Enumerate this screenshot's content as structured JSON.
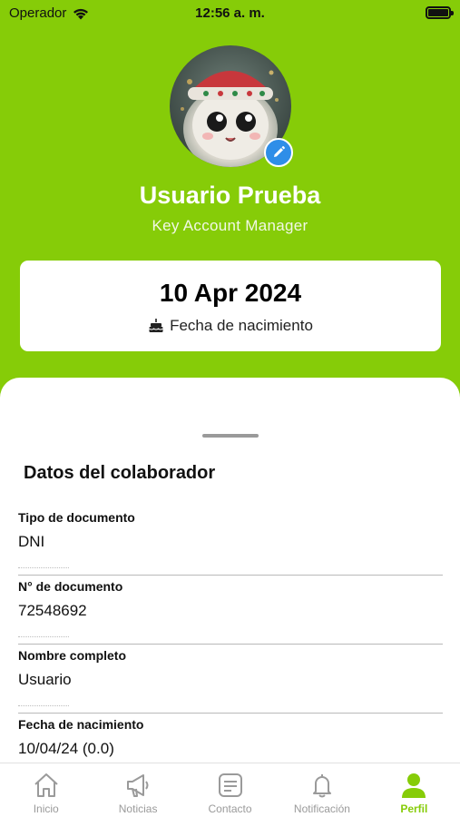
{
  "status_bar": {
    "carrier": "Operador",
    "time": "12:56 a. m.",
    "battery_level": 1.0
  },
  "profile": {
    "name": "Usuario Prueba",
    "role": "Key Account Manager",
    "avatar_icon": "fluffy-creature-avatar",
    "edit_icon": "pencil-icon"
  },
  "birthday_card": {
    "date": "10 Apr 2024",
    "label": "Fecha de nacimiento",
    "icon": "cake-icon"
  },
  "details": {
    "title": "Datos del colaborador",
    "fields": [
      {
        "label": "Tipo de documento",
        "value": "DNI"
      },
      {
        "label": "N° de documento",
        "value": "72548692"
      },
      {
        "label": "Nombre completo",
        "value": "Usuario"
      },
      {
        "label": "Fecha de nacimiento",
        "value": "10/04/24 (0.0)"
      }
    ]
  },
  "tabbar": {
    "items": [
      {
        "label": "Inicio",
        "icon": "home-icon",
        "active": false
      },
      {
        "label": "Noticias",
        "icon": "megaphone-icon",
        "active": false
      },
      {
        "label": "Contacto",
        "icon": "message-icon",
        "active": false
      },
      {
        "label": "Notificación",
        "icon": "bell-icon",
        "active": false
      },
      {
        "label": "Perfil",
        "icon": "person-icon",
        "active": true
      }
    ]
  },
  "colors": {
    "accent": "#86cc08",
    "edit_badge": "#2e8ee8",
    "inactive_tab": "#9a9a9a"
  }
}
